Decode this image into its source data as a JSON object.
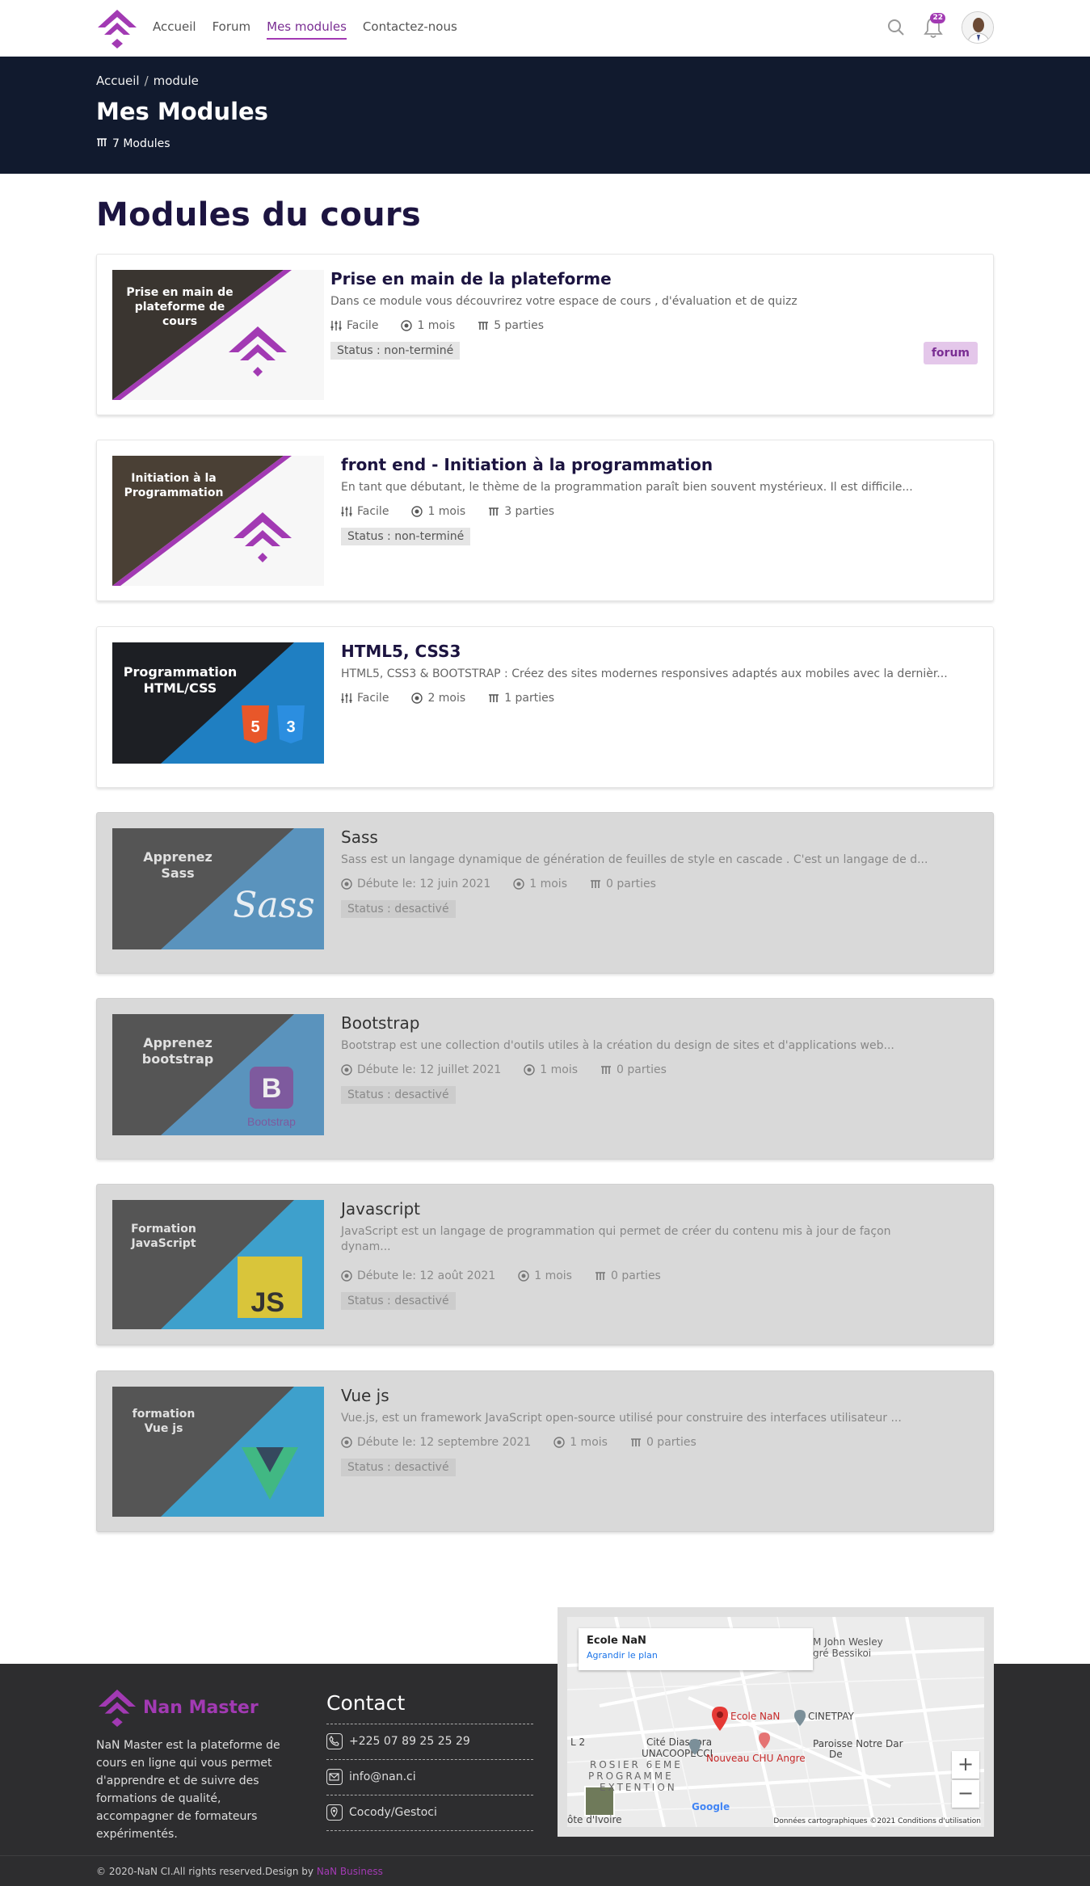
{
  "nav": {
    "links": [
      "Accueil",
      "Forum",
      "Mes modules",
      "Contactez-nous"
    ],
    "active_index": 2,
    "notification_count": "22",
    "icons": [
      "logo-icon",
      "search-icon",
      "bell-icon",
      "avatar"
    ]
  },
  "hero": {
    "crumb_home": "Accueil",
    "crumb_sep": "/",
    "crumb_current": "module",
    "title": "Mes Modules",
    "count": "7 Modules"
  },
  "section_title": "Modules du cours",
  "modules": [
    {
      "thumb_text": "Prise en main de plateforme de cours",
      "title": "Prise en main de la plateforme",
      "desc": "Dans ce module vous découvrirez votre espace de cours , d'évaluation et de quizz",
      "level": "Facile",
      "duration": "1 mois",
      "parts": "5 parties",
      "status": "Status : non-terminé",
      "badge": "forum"
    },
    {
      "thumb_text": "Initiation à la Programmation",
      "title": "front end - Initiation à la programmation",
      "desc": "En tant que débutant, le thème de la programmation paraît bien souvent mystérieux. Il est difficile...",
      "level": "Facile",
      "duration": "1 mois",
      "parts": "3 parties",
      "status": "Status : non-terminé"
    },
    {
      "thumb_text": "Programmation HTML/CSS",
      "title": "HTML5, CSS3",
      "desc": "HTML5, CSS3 & BOOTSTRAP : Créez des sites modernes responsives adaptés aux mobiles avec la dernièr...",
      "level": "Facile",
      "duration": "2 mois",
      "parts": "1 parties"
    },
    {
      "thumb_text": "Apprenez Sass",
      "thumb_logo": "Sass",
      "title": "Sass",
      "desc": "Sass est un langage dynamique de génération de feuilles de style en cascade . C'est un langage de d...",
      "start": "Débute le: 12 juin 2021",
      "duration": "1 mois",
      "parts": "0 parties",
      "status": "Status : desactivé"
    },
    {
      "thumb_text": "Apprenez bootstrap",
      "thumb_logo": "B",
      "thumb_logo_sub": "Bootstrap",
      "title": "Bootstrap",
      "desc": "Bootstrap est une collection d'outils utiles à la création du design de sites et d'applications web...",
      "start": "Débute le: 12 juillet 2021",
      "duration": "1 mois",
      "parts": "0 parties",
      "status": "Status : desactivé"
    },
    {
      "thumb_text": "Formation JavaScript",
      "thumb_logo": "JS",
      "title": "Javascript",
      "desc": "JavaScript est un langage de programmation qui permet de créer du contenu mis à jour de façon dynam...",
      "start": "Débute le: 12 août 2021",
      "duration": "1 mois",
      "parts": "0 parties",
      "status": "Status : desactivé"
    },
    {
      "thumb_text": "formation Vue js",
      "title": "Vue js",
      "desc": "Vue.js, est un framework JavaScript open-source utilisé pour construire des interfaces utilisateur ...",
      "start": "Débute le: 12 septembre 2021",
      "duration": "1 mois",
      "parts": "0 parties",
      "status": "Status : desactivé"
    }
  ],
  "footer": {
    "brand": "Nan Master",
    "about": "NaN Master est la plateforme de cours en ligne qui vous permet d'apprendre et de suivre des formations de qualité, accompagner de formateurs expérimentés.",
    "contact_title": "Contact",
    "phone": "+225 07 89 25 25 29",
    "email": "info@nan.ci",
    "address": "Cocody/Gestoci",
    "copy": "© 2020-NaN CI.All rights reserved.Design by ",
    "copy_link": "NaN Business"
  },
  "map": {
    "place_name": "Ecole NaN",
    "enlarge": "Agrandir le plan",
    "labels": {
      "pin": "Ecole NaN",
      "cinetpay": "CINETPAY",
      "chu": "Nouveau CHU Angre",
      "diaspora1": "Cité Diaspora",
      "diaspora2": "UNACOOPECCI",
      "paroisse1": "Paroisse Notre Dar",
      "paroisse2": "De",
      "wesley1": "M John Wesley",
      "wesley2": "gré Bessikoi",
      "rosier1": "ROSIER 6EME",
      "rosier2": "PROGRAMME",
      "rosier3": "EXTENTION",
      "l2": "L 2",
      "ivoire": "ôte d'Ivoire",
      "google": "Google"
    },
    "attribution": "Données cartographiques ©2021    Conditions d'utilisation",
    "zoom_in": "+",
    "zoom_out": "−"
  }
}
